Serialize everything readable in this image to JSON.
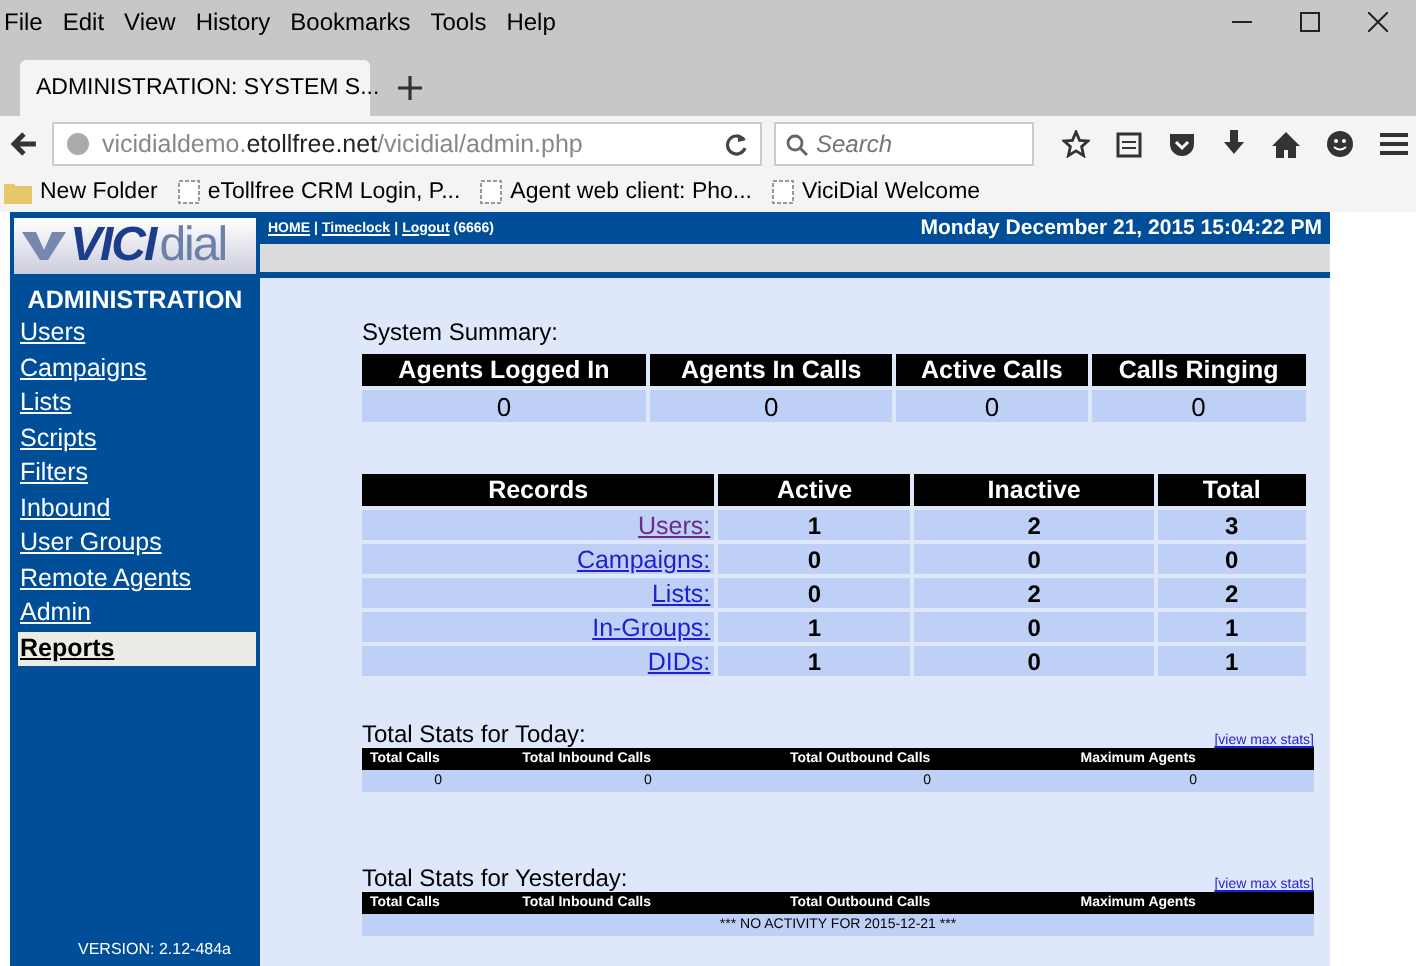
{
  "menu_bar": [
    "File",
    "Edit",
    "View",
    "History",
    "Bookmarks",
    "Tools",
    "Help"
  ],
  "tabs": [
    {
      "title": "ADMINISTRATION: SYSTEM S...",
      "selected": true
    }
  ],
  "address_bar": {
    "host_prefix": "vicidialdemo.",
    "host": "etollfree.net",
    "path": "/vicidial/admin.php"
  },
  "search": {
    "placeholder": "Search"
  },
  "bookmarks": [
    {
      "label": "New Folder",
      "kind": "folder"
    },
    {
      "label": "eTollfree CRM Login, P...",
      "kind": "page"
    },
    {
      "label": "Agent web client: Pho...",
      "kind": "page"
    },
    {
      "label": "ViciDial Welcome",
      "kind": "page"
    }
  ],
  "logo": {
    "bold": "VICI",
    "light": "dial"
  },
  "header": {
    "links": [
      "HOME",
      "Timeclock",
      "Logout"
    ],
    "separator": "|",
    "user": "(6666)",
    "datetime": "Monday December 21, 2015 15:04:22 PM"
  },
  "sidebar": {
    "title": "ADMINISTRATION",
    "items": [
      {
        "label": "Users",
        "selected": false
      },
      {
        "label": "Campaigns",
        "selected": false
      },
      {
        "label": "Lists",
        "selected": false
      },
      {
        "label": "Scripts",
        "selected": false
      },
      {
        "label": "Filters",
        "selected": false
      },
      {
        "label": "Inbound",
        "selected": false
      },
      {
        "label": "User Groups",
        "selected": false
      },
      {
        "label": "Remote Agents",
        "selected": false
      },
      {
        "label": "Admin",
        "selected": false
      },
      {
        "label": "Reports",
        "selected": true
      }
    ],
    "version": "VERSION: 2.12-484a"
  },
  "system_summary": {
    "title": "System Summary:",
    "columns": [
      "Agents Logged In",
      "Agents In Calls",
      "Active Calls",
      "Calls Ringing"
    ],
    "values": [
      "0",
      "0",
      "0",
      "0"
    ]
  },
  "records": {
    "columns": [
      "Records",
      "Active",
      "Inactive",
      "Total"
    ],
    "rows": [
      {
        "visited": true,
        "cells": [
          "Users:",
          "1",
          "2",
          "3"
        ]
      },
      {
        "visited": false,
        "cells": [
          "Campaigns:",
          "0",
          "0",
          "0"
        ]
      },
      {
        "visited": false,
        "cells": [
          "Lists:",
          "0",
          "2",
          "2"
        ]
      },
      {
        "visited": false,
        "cells": [
          "In-Groups:",
          "1",
          "0",
          "1"
        ]
      },
      {
        "visited": false,
        "cells": [
          "DIDs:",
          "1",
          "0",
          "1"
        ]
      }
    ]
  },
  "stats": [
    {
      "title": "Total Stats for Today:",
      "link": "[view max stats]",
      "columns": [
        "Total Calls",
        "Total Inbound Calls",
        "Total Outbound Calls",
        "Maximum Agents"
      ],
      "values": [
        "0",
        "0",
        "0",
        "0"
      ]
    },
    {
      "title": "Total Stats for Yesterday:",
      "link": "[view max stats]",
      "columns": [
        "Total Calls",
        "Total Inbound Calls",
        "Total Outbound Calls",
        "Maximum Agents"
      ],
      "message": "*** NO ACTIVITY FOR 2015-12-21 ***"
    }
  ]
}
